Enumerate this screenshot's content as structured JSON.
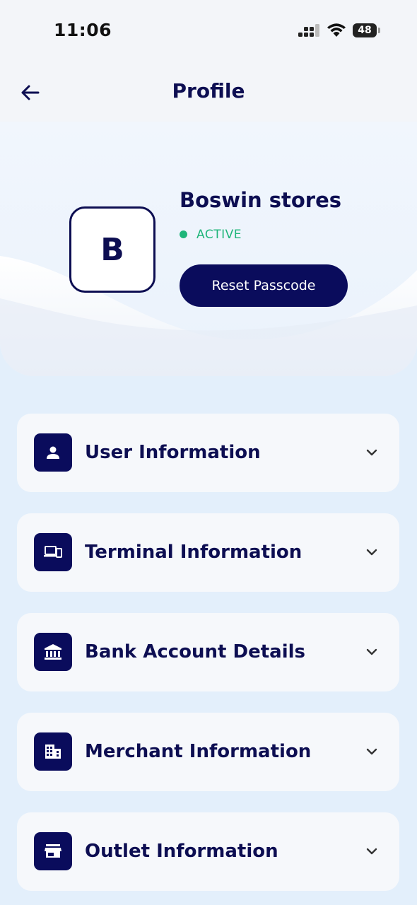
{
  "status_bar": {
    "time": "11:06",
    "battery": "48",
    "icons": [
      "signal-icon",
      "wifi-icon",
      "battery-icon"
    ]
  },
  "nav": {
    "title": "Profile",
    "back_icon": "arrow-left-icon"
  },
  "profile": {
    "avatar_letter": "B",
    "store_name": "Boswin stores",
    "status": "ACTIVE",
    "reset_button_label": "Reset Passcode"
  },
  "sections": [
    {
      "label": "User Information",
      "icon": "person-icon"
    },
    {
      "label": "Terminal Information",
      "icon": "devices-icon"
    },
    {
      "label": "Bank Account Details",
      "icon": "bank-icon"
    },
    {
      "label": "Merchant Information",
      "icon": "building-icon"
    },
    {
      "label": "Outlet Information",
      "icon": "store-icon"
    }
  ],
  "colors": {
    "primary": "#0a0c5c",
    "active": "#1fb57a",
    "background": "#e3effb",
    "card": "#f6f8fb"
  }
}
